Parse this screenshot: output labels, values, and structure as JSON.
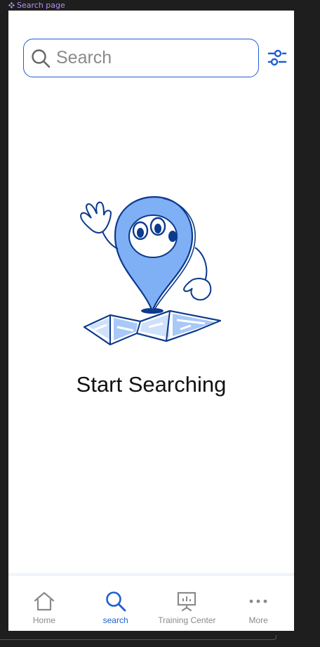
{
  "frame": {
    "label": "Search page"
  },
  "search": {
    "placeholder": "Search",
    "value": ""
  },
  "empty_state": {
    "title": "Start Searching"
  },
  "colors": {
    "accent": "#1f5fd1",
    "illustration_light": "#7fb0f5",
    "text_muted": "#8a8a8a"
  },
  "nav": {
    "items": [
      {
        "label": "Home",
        "icon": "home-icon",
        "active": false
      },
      {
        "label": "search",
        "icon": "search-icon",
        "active": true
      },
      {
        "label": "Training Center",
        "icon": "presentation-board-icon",
        "active": false
      },
      {
        "label": "More",
        "icon": "more-dots-icon",
        "active": false
      }
    ]
  }
}
